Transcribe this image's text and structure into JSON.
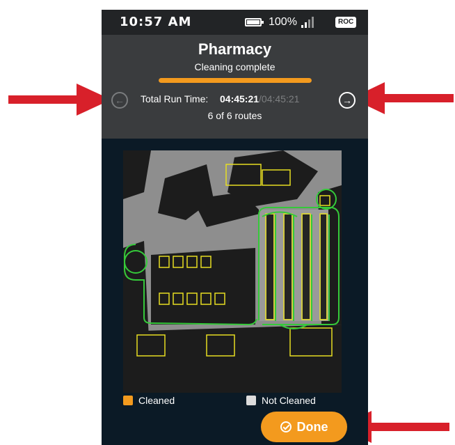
{
  "status_bar": {
    "time": "10:57 AM",
    "battery_icon": "battery-full-icon",
    "battery_percent": "100%",
    "signal_icon": "signal-bars-icon",
    "carrier": "ROC"
  },
  "header": {
    "title": "Pharmacy",
    "subtitle": "Cleaning complete",
    "progress_fraction": 1.0,
    "run_time_label": "Total Run Time:",
    "run_time_value": "04:45:21",
    "run_time_total": "/04:45:21",
    "routes_text": "6 of 6 routes",
    "prev_icon": "arrow-left-circle-icon",
    "next_icon": "arrow-right-circle-icon"
  },
  "legend": {
    "cleaned_label": "Cleaned",
    "not_cleaned_label": "Not Cleaned"
  },
  "done_button": {
    "label": "Done",
    "icon": "check-circle-icon"
  },
  "colors": {
    "accent_orange": "#f39a1e",
    "header_bg": "#3a3c3e",
    "status_bg": "#222426",
    "screen_bg": "#0b1a26",
    "map_bg": "#8e8e8e",
    "route_green": "#35c93a",
    "obstacle_yellow": "#e6dd22",
    "not_cleaned_swatch": "#dcdcdc",
    "annotation_red": "#d8202a"
  }
}
